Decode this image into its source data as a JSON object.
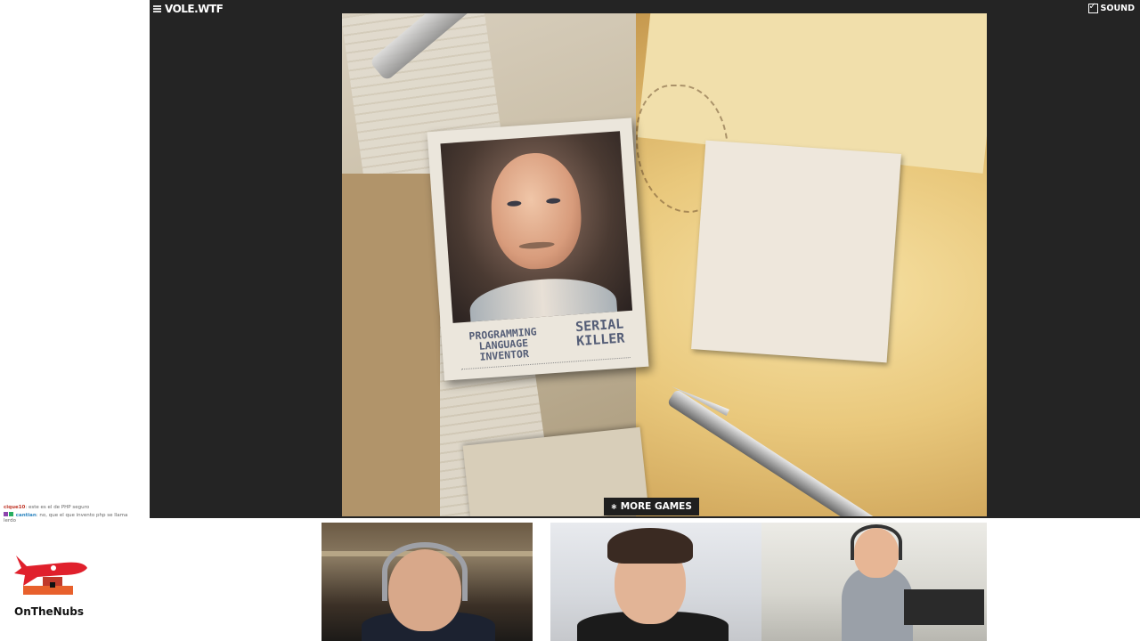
{
  "game": {
    "brand": "VOLE.WTF",
    "sound_label": "SOUND",
    "sound_checked": true,
    "card": {
      "left_option": "PROGRAMMING LANGUAGE INVENTOR",
      "right_option": "SERIAL KILLER"
    },
    "more_games_label": "MORE GAMES"
  },
  "chat": {
    "messages": [
      {
        "user": "cique10",
        "text": "este es el de PHP seguro",
        "user_color": "#c0392b"
      },
      {
        "user": "cantian",
        "text": "no, que el que invento php se llama lerdo",
        "user_color": "#2e86c1"
      }
    ]
  },
  "channel": {
    "name": "OnTheNubs",
    "accent": "#e0202c"
  },
  "icons": {
    "menu": "hamburger-menu-icon",
    "sound": "checkbox-icon",
    "more_games": "star-icon"
  }
}
